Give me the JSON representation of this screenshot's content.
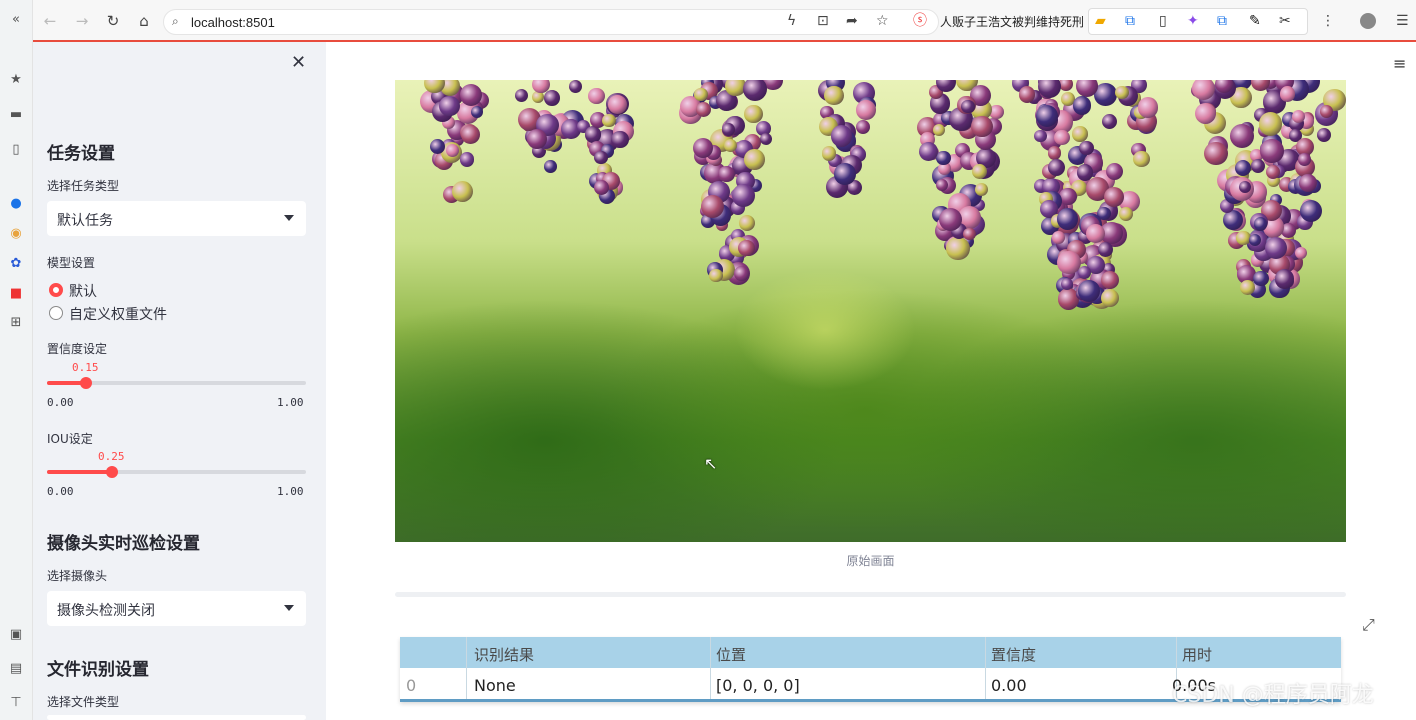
{
  "browser": {
    "address": "localhost:8501",
    "news_tab": "人贩子王浩文被判维持死刑"
  },
  "sidebar": {
    "task_heading": "任务设置",
    "task_type_label": "选择任务类型",
    "task_type_value": "默认任务",
    "model_label": "模型设置",
    "model_options": [
      "默认",
      "自定义权重文件"
    ],
    "model_selected": 0,
    "conf_label": "置信度设定",
    "conf_value": "0.15",
    "conf_fraction": 0.15,
    "conf_min": "0.00",
    "conf_max": "1.00",
    "iou_label": "IOU设定",
    "iou_value": "0.25",
    "iou_fraction": 0.25,
    "iou_min": "0.00",
    "iou_max": "1.00",
    "camera_heading": "摄像头实时巡检设置",
    "camera_label": "选择摄像头",
    "camera_value": "摄像头检测关闭",
    "file_heading": "文件识别设置",
    "file_label": "选择文件类型"
  },
  "main": {
    "caption": "原始画面",
    "table": {
      "headers": [
        "",
        "识别结果",
        "位置",
        "置信度",
        "用时"
      ],
      "row": [
        "0",
        "None",
        "[0, 0, 0, 0]",
        "0.00",
        "0.00s"
      ]
    }
  },
  "watermark": "CSDN @程序员阿龙",
  "colors": {
    "accent": "#ff4b4b",
    "table_header": "#a8d2e8",
    "sidebar_bg": "#f0f2f6"
  }
}
